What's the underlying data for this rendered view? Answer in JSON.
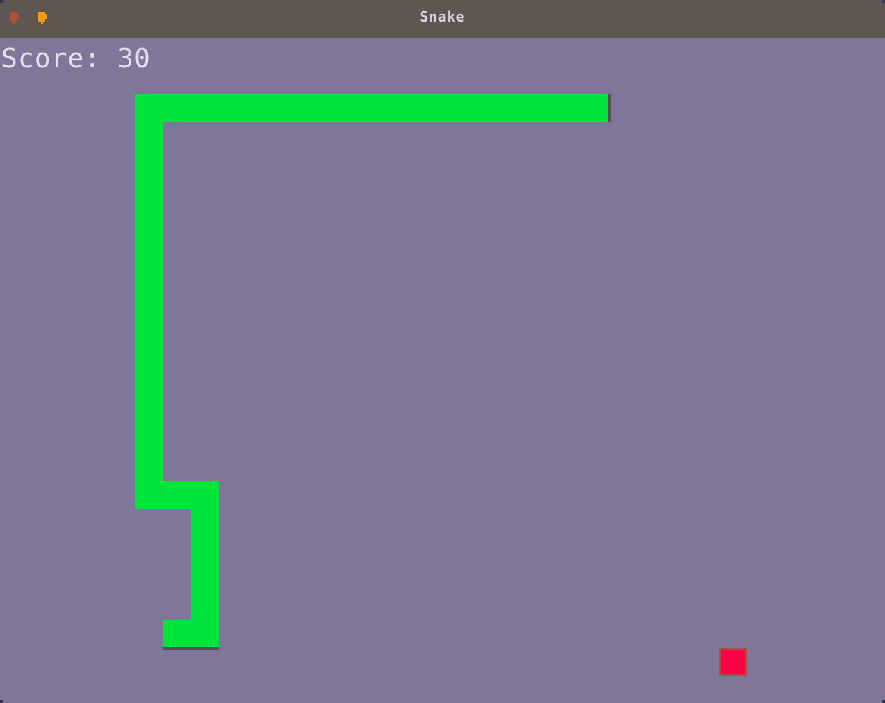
{
  "window": {
    "title": "Snake",
    "buttons": [
      {
        "name": "close",
        "icon": "close-icon",
        "color": "#b0503a"
      },
      {
        "name": "minimize",
        "icon": "minimize-icon",
        "color": "#f39a12"
      }
    ]
  },
  "game": {
    "score_label": "Score: 30",
    "score": 30,
    "colors": {
      "background": "#807699",
      "snake": "#00e53c",
      "food": "#ff0044",
      "titlebar": "#5e5751"
    }
  }
}
